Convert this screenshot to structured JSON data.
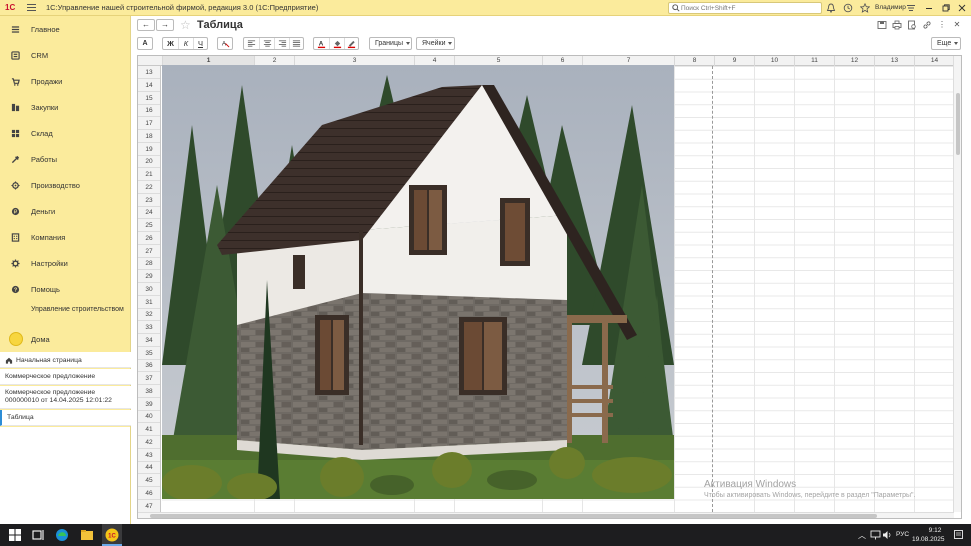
{
  "titlebar": {
    "logo": "1С",
    "app_title": "1С:Управление нашей строительной фирмой, редакция 3.0  (1С:Предприятие)",
    "search_placeholder": "Поиск Ctrl+Shift+F",
    "user_name": "Владимир",
    "icons": [
      "bell-icon",
      "history-icon",
      "star-icon",
      "settings-icon",
      "minimize-icon",
      "restore-icon",
      "close-icon"
    ]
  },
  "sidebar": {
    "items": [
      {
        "label": "Главное",
        "icon": "menu-lines-icon"
      },
      {
        "label": "CRM",
        "icon": "crm-icon"
      },
      {
        "label": "Продажи",
        "icon": "sales-icon"
      },
      {
        "label": "Закупки",
        "icon": "purchases-icon"
      },
      {
        "label": "Склад",
        "icon": "warehouse-icon"
      },
      {
        "label": "Работы",
        "icon": "tools-icon"
      },
      {
        "label": "Производство",
        "icon": "factory-icon"
      },
      {
        "label": "Деньги",
        "icon": "money-icon"
      },
      {
        "label": "Компания",
        "icon": "company-icon"
      },
      {
        "label": "Настройки",
        "icon": "gear-icon"
      },
      {
        "label": "Помощь",
        "icon": "help-icon"
      },
      {
        "label": "Управление строительством",
        "icon": "construction-icon"
      },
      {
        "label": "Дома",
        "icon": "yellow-circle-icon"
      }
    ],
    "open_windows": {
      "home": "Начальная страница",
      "item1": "Коммерческое предложение",
      "item2": "Коммерческое предложение 000000010 от 14.04.2025 12:01:22",
      "item3": "Таблица"
    }
  },
  "content": {
    "title": "Таблица",
    "toolbar": {
      "font_btn": "A",
      "bold": "Ж",
      "italic": "К",
      "underline": "Ч",
      "borders": "Границы",
      "cells": "Ячейки",
      "more": "Еще"
    }
  },
  "sheet": {
    "columns": [
      "1",
      "2",
      "3",
      "4",
      "5",
      "6",
      "7",
      "8",
      "9",
      "10",
      "11",
      "12",
      "13",
      "14"
    ],
    "rows": [
      "13",
      "14",
      "15",
      "16",
      "17",
      "18",
      "19",
      "20",
      "21",
      "22",
      "23",
      "24",
      "25",
      "26",
      "27",
      "28",
      "29",
      "30",
      "31",
      "32",
      "33",
      "34",
      "35",
      "36",
      "37",
      "38",
      "39",
      "40",
      "41",
      "42",
      "43",
      "44",
      "45",
      "46",
      "47"
    ],
    "picture": "house-render-image"
  },
  "watermark": {
    "line1": "Активация Windows",
    "line2": "Чтобы активировать Windows, перейдите в раздел \"Параметры\"."
  },
  "taskbar": {
    "lang": "РУС",
    "time": "9:12",
    "date": "19.08.2025"
  },
  "colors": {
    "sidebar_bg": "#fbeb9c",
    "taskbar_bg": "#1d1d1f",
    "brand_red": "#c8102e"
  }
}
